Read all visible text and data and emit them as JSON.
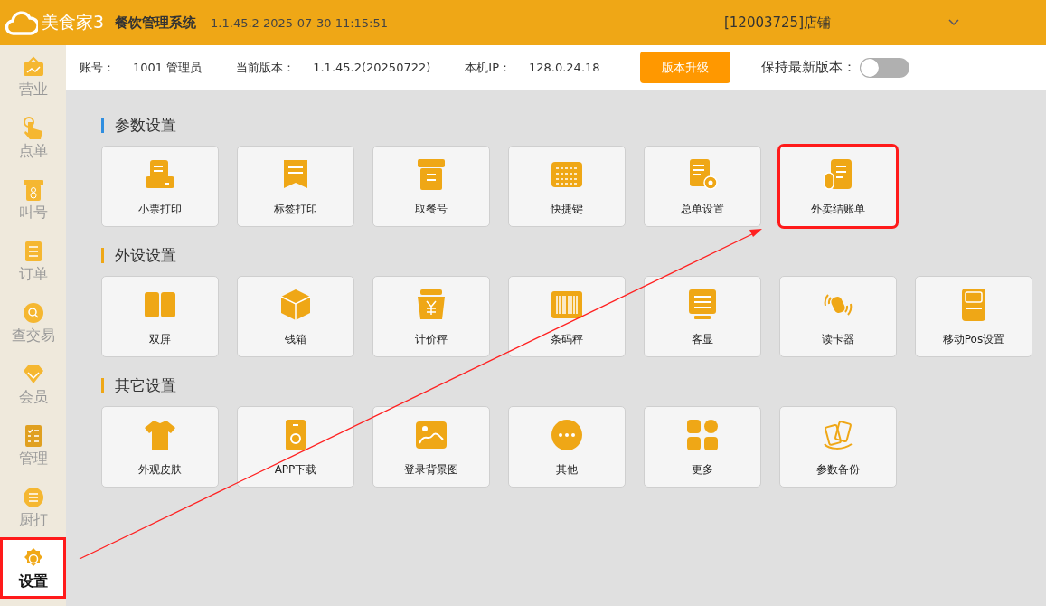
{
  "header": {
    "logo_text": "美食家3",
    "app_name": "餐饮管理系统",
    "version_time": "1.1.45.2 2025-07-30 11:15:51",
    "store": "[12003725]店铺"
  },
  "info_bar": {
    "account_label": "账号：",
    "account_value": "1001 管理员",
    "version_label": "当前版本：",
    "version_value": "1.1.45.2(20250722)",
    "ip_label": "本机IP：",
    "ip_value": "128.0.24.18",
    "upgrade_button": "版本升级",
    "keep_latest_label": "保持最新版本：",
    "keep_latest_on": false
  },
  "sidebar": {
    "items": [
      {
        "label": "营业",
        "selected": false,
        "highlighted": false
      },
      {
        "label": "点单",
        "selected": false,
        "highlighted": false
      },
      {
        "label": "叫号",
        "selected": false,
        "highlighted": false
      },
      {
        "label": "订单",
        "selected": false,
        "highlighted": false
      },
      {
        "label": "查交易",
        "selected": false,
        "highlighted": false
      },
      {
        "label": "会员",
        "selected": false,
        "highlighted": false
      },
      {
        "label": "管理",
        "selected": false,
        "highlighted": false
      },
      {
        "label": "厨打",
        "selected": false,
        "highlighted": false
      },
      {
        "label": "设置",
        "selected": true,
        "highlighted": true
      }
    ]
  },
  "sections": [
    {
      "title": "参数设置",
      "color": "#2f8ee0",
      "tiles": [
        {
          "label": "小票打印",
          "highlighted": false
        },
        {
          "label": "标签打印",
          "highlighted": false
        },
        {
          "label": "取餐号",
          "highlighted": false
        },
        {
          "label": "快捷键",
          "highlighted": false
        },
        {
          "label": "总单设置",
          "highlighted": false
        },
        {
          "label": "外卖结账单",
          "highlighted": true
        }
      ]
    },
    {
      "title": "外设设置",
      "color": "#efa716",
      "tiles": [
        {
          "label": "双屏",
          "highlighted": false
        },
        {
          "label": "钱箱",
          "highlighted": false
        },
        {
          "label": "计价秤",
          "highlighted": false
        },
        {
          "label": "条码秤",
          "highlighted": false
        },
        {
          "label": "客显",
          "highlighted": false
        },
        {
          "label": "读卡器",
          "highlighted": false
        },
        {
          "label": "移动Pos设置",
          "highlighted": false
        }
      ]
    },
    {
      "title": "其它设置",
      "color": "#efa716",
      "tiles": [
        {
          "label": "外观皮肤",
          "highlighted": false
        },
        {
          "label": "APP下载",
          "highlighted": false
        },
        {
          "label": "登录背景图",
          "highlighted": false
        },
        {
          "label": "其他",
          "highlighted": false
        },
        {
          "label": "更多",
          "highlighted": false
        },
        {
          "label": "参数备份",
          "highlighted": false
        }
      ]
    }
  ]
}
